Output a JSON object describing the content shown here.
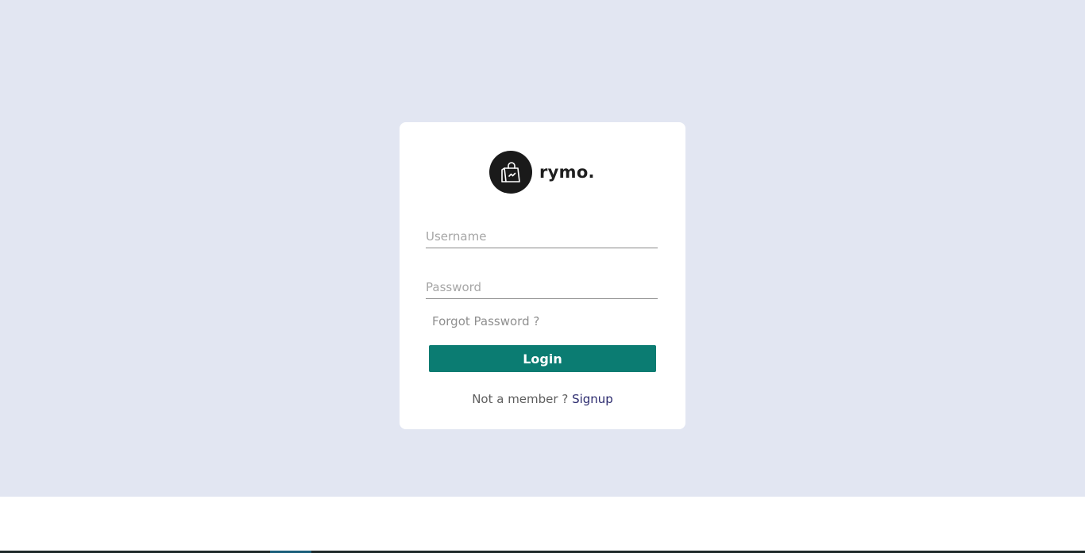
{
  "brand": {
    "name": "rymo.",
    "logo_icon": "shopping-bag-icon"
  },
  "form": {
    "username_placeholder": "Username",
    "password_placeholder": "Password",
    "forgot_label": "Forgot Password ?",
    "login_label": "Login",
    "signup_prompt": "Not a member ? ",
    "signup_label": "Signup"
  },
  "colors": {
    "background": "#e2e6f2",
    "card": "#ffffff",
    "accent": "#0b7c72",
    "signup_link": "#2b2a6e"
  }
}
